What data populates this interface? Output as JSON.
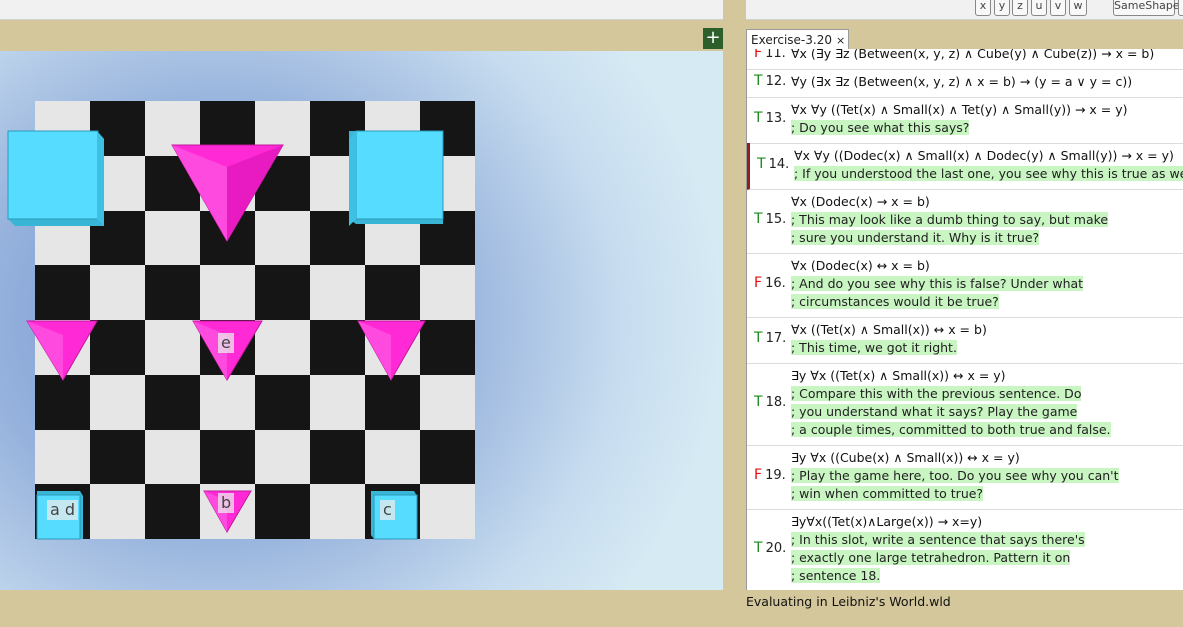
{
  "toolbar": {
    "var_buttons": [
      "x",
      "y",
      "z",
      "u",
      "v",
      "w"
    ],
    "same_shape": "SameShape"
  },
  "world": {
    "add_label": "+",
    "labels": {
      "ad": "a d",
      "e": "e",
      "b": "b",
      "c": "c"
    }
  },
  "tab": {
    "title": "Exercise-3.20",
    "close": "×"
  },
  "sentences": [
    {
      "tv": "F",
      "num": "11.",
      "lines": [
        "∀x (∃y ∃z (Between(x, y, z) ∧ Cube(y) ∧ Cube(z)) → x = b)"
      ],
      "comments": []
    },
    {
      "tv": "T",
      "num": "12.",
      "lines": [
        "∀y (∃x ∃z (Between(x, y, z) ∧ x = b) → (y = a ∨ y = c))"
      ],
      "comments": []
    },
    {
      "tv": "T",
      "num": "13.",
      "lines": [
        "∀x ∀y ((Tet(x) ∧ Small(x) ∧ Tet(y) ∧ Small(y)) → x = y)"
      ],
      "comments": [
        "; Do you see what this says?"
      ]
    },
    {
      "tv": "T",
      "num": "14.",
      "lines": [
        "∀x ∀y ((Dodec(x) ∧ Small(x) ∧ Dodec(y) ∧ Small(y)) → x = y)"
      ],
      "comments": [
        "; If you understood the last one, you see why this is true as well."
      ]
    },
    {
      "tv": "T",
      "num": "15.",
      "lines": [
        "∀x (Dodec(x) → x = b)"
      ],
      "comments": [
        "; This may look like a dumb thing to say, but make ",
        "; sure you understand it.  Why is it true?"
      ]
    },
    {
      "tv": "F",
      "num": "16.",
      "lines": [
        "∀x (Dodec(x) ↔ x = b)"
      ],
      "comments": [
        "; And do you see why this is false?  Under what ",
        "; circumstances would it be true?"
      ]
    },
    {
      "tv": "T",
      "num": "17.",
      "lines": [
        "∀x ((Tet(x) ∧ Small(x)) ↔ x = b)"
      ],
      "comments": [
        "; This time, we got it right."
      ]
    },
    {
      "tv": "T",
      "num": "18.",
      "lines": [
        "∃y ∀x ((Tet(x) ∧ Small(x)) ↔ x = y)"
      ],
      "comments": [
        "; Compare this with the previous sentence.  Do ",
        "; you understand what it says?  Play the game ",
        "; a couple times, committed to both true and false."
      ]
    },
    {
      "tv": "F",
      "num": "19.",
      "lines": [
        "∃y ∀x ((Cube(x) ∧ Small(x)) ↔ x = y)"
      ],
      "comments": [
        "; Play the game here, too.  Do you see why you can't ",
        "; win when committed to true?"
      ]
    },
    {
      "tv": "T",
      "num": "20.",
      "lines": [
        "∃y∀x((Tet(x)∧Large(x)) → x=y)"
      ],
      "comments": [
        "; In this slot, write a sentence that says there's ",
        "; exactly one large tetrahedron.  Pattern it on ",
        "; sentence 18."
      ]
    }
  ],
  "status": "Evaluating in Leibniz's World.wld",
  "colors": {
    "cube": "#55dcff",
    "tet": "#ff2ad6",
    "true": "#1a8a1a",
    "false": "#e01010",
    "comment_bg": "#c9f5c3"
  }
}
